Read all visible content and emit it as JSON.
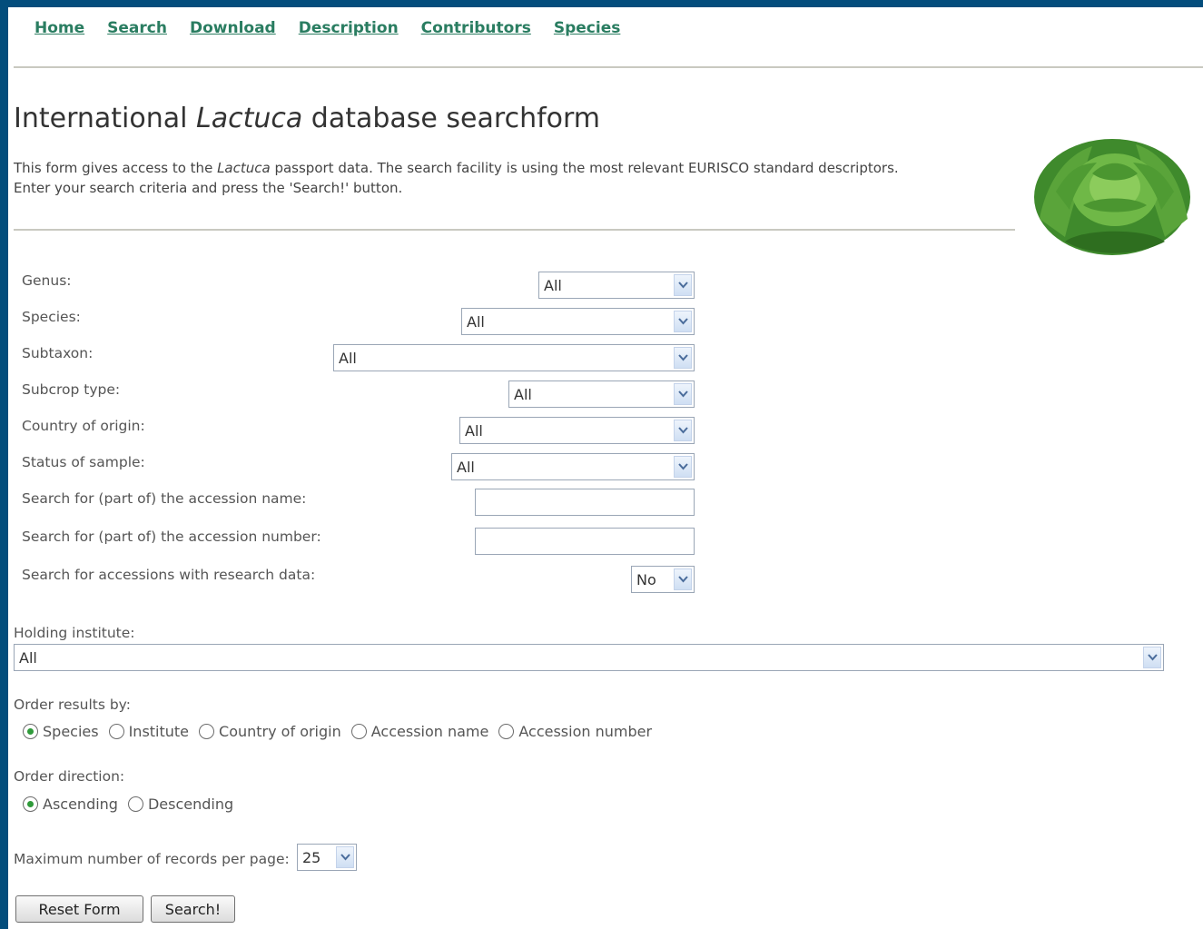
{
  "nav": {
    "items": [
      "Home",
      "Search",
      "Download",
      "Description",
      "Contributors",
      "Species"
    ]
  },
  "page": {
    "title_prefix": "International ",
    "title_italic": "Lactuca",
    "title_suffix": " database searchform",
    "intro_line1_prefix": "This form gives access to the ",
    "intro_line1_italic": "Lactuca",
    "intro_line1_suffix": " passport data. The search facility is using the most relevant EURISCO standard descriptors.",
    "intro_line2": "Enter your search criteria and press the 'Search!' button."
  },
  "form": {
    "genus": {
      "label": "Genus:",
      "value": "All"
    },
    "species": {
      "label": "Species:",
      "value": "All"
    },
    "subtaxon": {
      "label": "Subtaxon:",
      "value": "All"
    },
    "subcrop": {
      "label": "Subcrop type:",
      "value": "All"
    },
    "country": {
      "label": "Country of origin:",
      "value": "All"
    },
    "status": {
      "label": "Status of sample:",
      "value": "All"
    },
    "acc_name": {
      "label": "Search for (part of) the accession name:",
      "value": ""
    },
    "acc_number": {
      "label": "Search for (part of) the accession number:",
      "value": ""
    },
    "research": {
      "label": "Search for accessions with research data:",
      "value": "No"
    },
    "holding": {
      "label": "Holding institute:",
      "value": "All"
    },
    "order_by": {
      "label": "Order results by:",
      "options": [
        "Species",
        "Institute",
        "Country of origin",
        "Accession name",
        "Accession number"
      ],
      "selected": "Species"
    },
    "order_dir": {
      "label": "Order direction:",
      "options": [
        "Ascending",
        "Descending"
      ],
      "selected": "Ascending"
    },
    "max_records": {
      "label": "Maximum number of records per page:",
      "value": "25"
    },
    "reset_label": "Reset Form",
    "search_label": "Search!"
  },
  "colors": {
    "frame": "#034d7c",
    "nav_link": "#2a7d61",
    "radio_dot": "#2f9a3a"
  }
}
